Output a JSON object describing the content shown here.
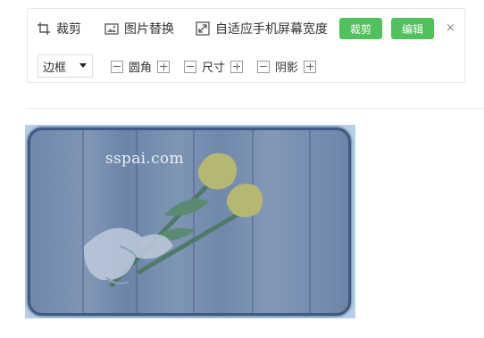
{
  "toolbar": {
    "crop_label": "裁剪",
    "replace_label": "图片替换",
    "fit_label": "自适应手机屏幕宽度",
    "crop_button": "裁剪",
    "edit_button": "编辑",
    "close": "×",
    "border_select": "边框",
    "radius_label": "圆角",
    "size_label": "尺寸",
    "shadow_label": "阴影"
  },
  "image": {
    "watermark": "sspai.com"
  },
  "colors": {
    "accent": "#52c15d",
    "selection": "#b7cde8",
    "frame_border": "#3f5a84"
  },
  "icons": [
    "crop-icon",
    "image-replace-icon",
    "fit-width-icon",
    "chevron-down-icon",
    "minus-icon",
    "plus-icon"
  ]
}
